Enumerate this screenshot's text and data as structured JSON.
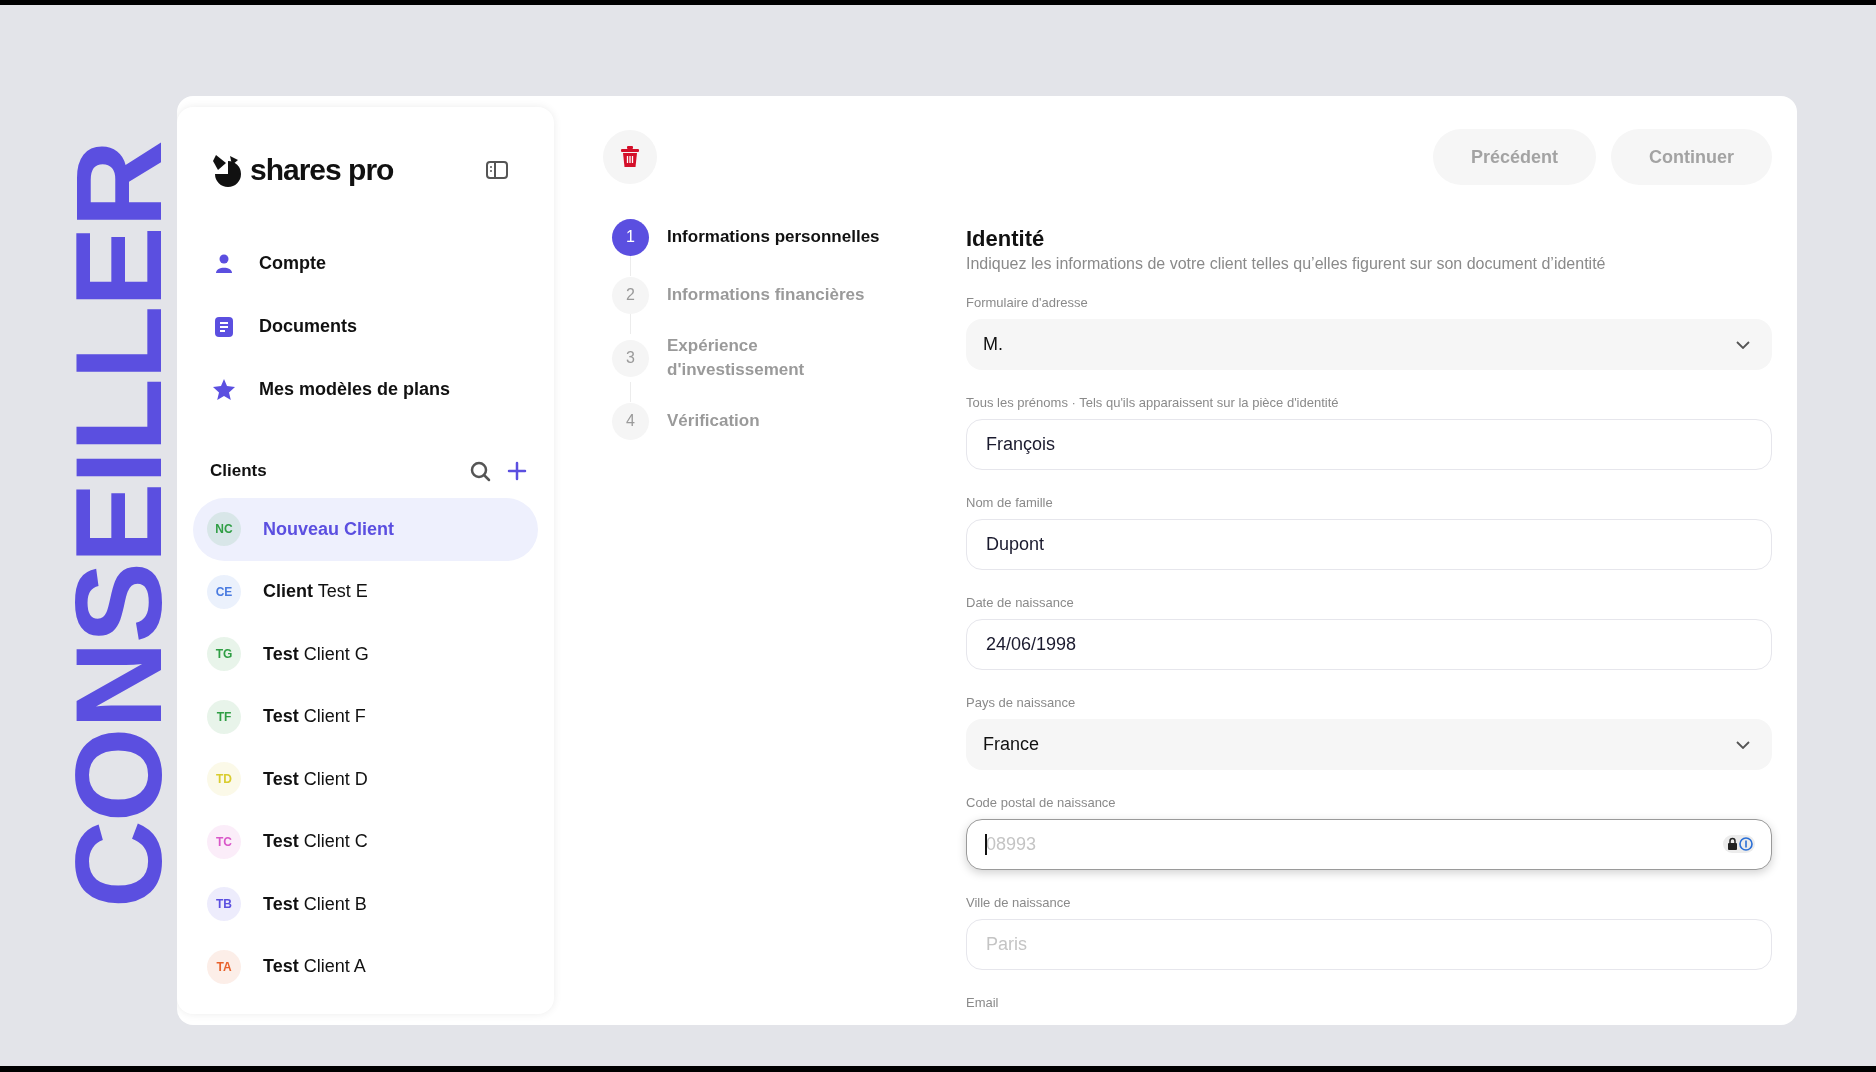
{
  "side_label": "CONSEILLER",
  "sidebar": {
    "logo": "shares pro",
    "nav": [
      {
        "label": "Compte"
      },
      {
        "label": "Documents"
      },
      {
        "label": "Mes modèles de plans"
      }
    ],
    "clients_title": "Clients",
    "clients": [
      {
        "initials": "NC",
        "name": "Nouveau Client",
        "color": "#2f9e44",
        "selected": true
      },
      {
        "initials": "CE",
        "name": "**Client** Test E",
        "color": "#4a7be0",
        "selected": false
      },
      {
        "initials": "TG",
        "name": "**Test** Client G",
        "color": "#2f9e44",
        "selected": false
      },
      {
        "initials": "TF",
        "name": "**Test** Client F",
        "color": "#2f9e44",
        "selected": false
      },
      {
        "initials": "TD",
        "name": "**Test** Client D",
        "color": "#d9cc2e",
        "selected": false
      },
      {
        "initials": "TC",
        "name": "**Test** Client C",
        "color": "#d957c9",
        "selected": false
      },
      {
        "initials": "TB",
        "name": "**Test** Client B",
        "color": "#5b4fe0",
        "selected": false
      },
      {
        "initials": "TA",
        "name": "**Test** Client A",
        "color": "#e8622c",
        "selected": false
      }
    ]
  },
  "toolbar": {
    "buttons": [
      {
        "label": "Précédent",
        "disabled": true
      },
      {
        "label": "Continuer",
        "disabled": true
      }
    ]
  },
  "steps": [
    {
      "number": "1",
      "label": "Informations personnelles",
      "selected": true
    },
    {
      "number": "2",
      "label": "Informations financières",
      "selected": false
    },
    {
      "number": "3",
      "label": "Expérience d'investissement",
      "selected": false
    },
    {
      "number": "4",
      "label": "Vérification",
      "selected": false
    }
  ],
  "form": {
    "title": "Identité",
    "subtitle": "Indiquez les informations de votre client telles qu’elles figurent sur son document d’identité",
    "fields": [
      {
        "label": "Formulaire d'adresse",
        "kind": "select",
        "value": "M."
      },
      {
        "label": "Tous les prénoms · Tels qu'ils apparaissent sur la pièce d'identité",
        "kind": "input",
        "value": "François",
        "focused": false
      },
      {
        "label": "Nom de famille",
        "kind": "input",
        "value": "Dupont",
        "focused": false
      },
      {
        "label": "Date de naissance",
        "kind": "input",
        "value": "24/06/1998",
        "focused": false
      },
      {
        "label": "Pays de naissance",
        "kind": "select",
        "value": "France"
      },
      {
        "label": "Code postal de naissance",
        "kind": "input",
        "placeholder": "08993",
        "focused": true
      },
      {
        "label": "Ville de naissance",
        "kind": "input",
        "placeholder": "Paris",
        "focused": false
      },
      {
        "label": "Email",
        "kind": "label"
      }
    ]
  }
}
